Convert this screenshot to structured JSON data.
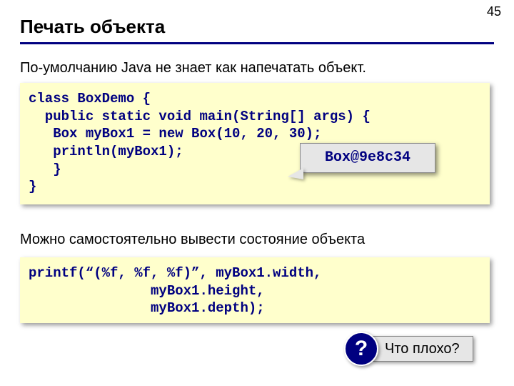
{
  "page_number": "45",
  "title": "Печать объекта",
  "subtitle1": "По-умолчанию Java не знает как напечатать объект.",
  "code1": "class BoxDemo {\n  public static void main(String[] args) {\n   Box myBox1 = new Box(10, 20, 30);\n   println(myBox1);\n   }\n}",
  "callout_output": "Box@9e8c34",
  "subtitle2": "Можно самостоятельно вывести состояние объекта",
  "code2": "printf(“(%f, %f, %f)”, myBox1.width,\n               myBox1.height,\n               myBox1.depth);",
  "question_mark": "?",
  "question_text": "Что плохо?"
}
